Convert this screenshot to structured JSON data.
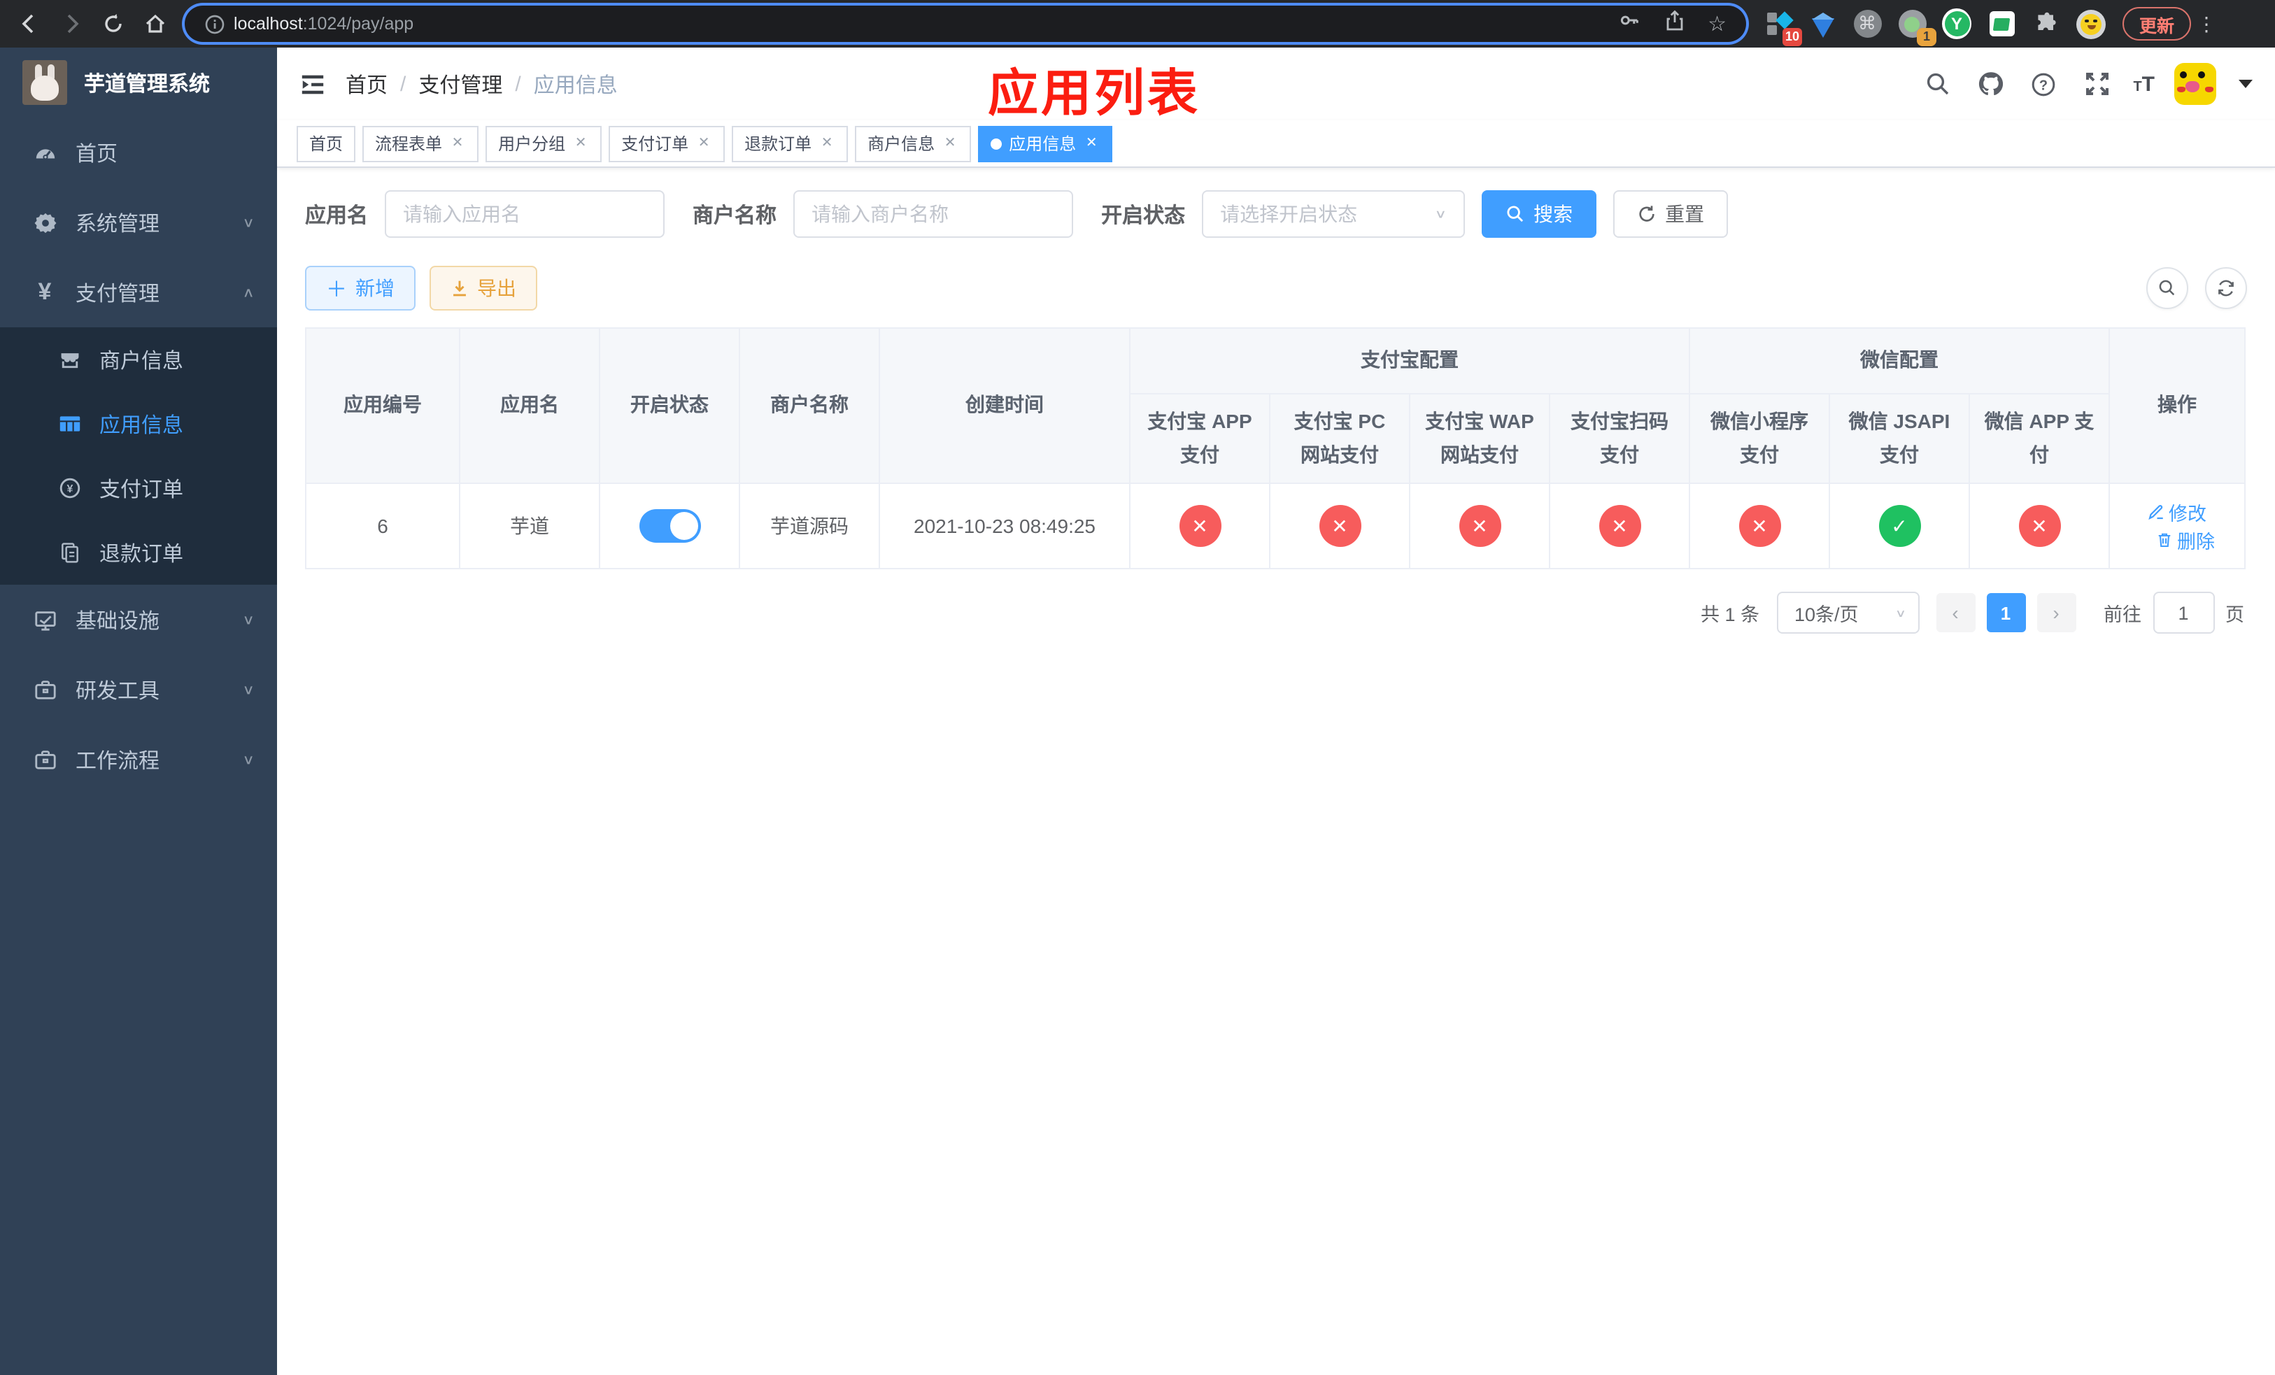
{
  "browser": {
    "url_host": "localhost",
    "url_rest": ":1024/pay/app",
    "update_label": "更新",
    "ext_badge_count_1": "10",
    "ext_badge_count_2": "1",
    "ext_y_label": "Y"
  },
  "sidebar": {
    "title": "芋道管理系统",
    "items": [
      {
        "label": "首页",
        "icon": "dashboard-icon"
      },
      {
        "label": "系统管理",
        "icon": "gear-icon",
        "chevron": "down"
      },
      {
        "label": "支付管理",
        "icon": "yen-icon",
        "chevron": "up"
      },
      {
        "label": "商户信息",
        "icon": "shop-icon",
        "submenu": true
      },
      {
        "label": "应用信息",
        "icon": "grid-icon",
        "submenu": true,
        "active": true
      },
      {
        "label": "支付订单",
        "icon": "yen-circle-icon",
        "submenu": true
      },
      {
        "label": "退款订单",
        "icon": "document-icon",
        "submenu": true
      },
      {
        "label": "基础设施",
        "icon": "monitor-icon",
        "chevron": "down"
      },
      {
        "label": "研发工具",
        "icon": "briefcase-icon",
        "chevron": "down"
      },
      {
        "label": "工作流程",
        "icon": "briefcase-icon",
        "chevron": "down"
      }
    ]
  },
  "header": {
    "breadcrumbs": [
      "首页",
      "支付管理",
      "应用信息"
    ],
    "annotation": "应用列表"
  },
  "tabs": [
    {
      "label": "首页",
      "closable": false,
      "active": false
    },
    {
      "label": "流程表单",
      "closable": true,
      "active": false
    },
    {
      "label": "用户分组",
      "closable": true,
      "active": false
    },
    {
      "label": "支付订单",
      "closable": true,
      "active": false
    },
    {
      "label": "退款订单",
      "closable": true,
      "active": false
    },
    {
      "label": "商户信息",
      "closable": true,
      "active": false
    },
    {
      "label": "应用信息",
      "closable": true,
      "active": true
    }
  ],
  "filters": {
    "app_name_label": "应用名",
    "app_name_placeholder": "请输入应用名",
    "merchant_label": "商户名称",
    "merchant_placeholder": "请输入商户名称",
    "status_label": "开启状态",
    "status_placeholder": "请选择开启状态",
    "search_label": "搜索",
    "reset_label": "重置"
  },
  "toolbar": {
    "add_label": "新增",
    "export_label": "导出"
  },
  "table": {
    "group_alipay": "支付宝配置",
    "group_wechat": "微信配置",
    "headers": [
      "应用编号",
      "应用名",
      "开启状态",
      "商户名称",
      "创建时间"
    ],
    "ops_header": "操作",
    "pay_headers": [
      "支付宝 APP 支付",
      "支付宝 PC 网站支付",
      "支付宝 WAP 网站支付",
      "支付宝扫码支付",
      "微信小程序支付",
      "微信 JSAPI 支付",
      "微信 APP 支付"
    ],
    "row": {
      "id": "6",
      "name": "芋道",
      "enabled": true,
      "merchant": "芋道源码",
      "created_at": "2021-10-23 08:49:25",
      "pay_status": [
        false,
        false,
        false,
        false,
        false,
        true,
        false
      ],
      "edit_label": "修改",
      "delete_label": "删除"
    }
  },
  "pagination": {
    "total_text": "共 1 条",
    "page_size": "10条/页",
    "current_page": "1",
    "goto_label": "前往",
    "goto_value": "1",
    "page_suffix": "页"
  },
  "colors": {
    "accent_blue": "#409eff",
    "sidebar_bg": "#304156",
    "submenu_bg": "#1f2d3d",
    "status_red": "#f75c5c",
    "status_green": "#1fc161",
    "annotation_red": "#fb1d10"
  }
}
